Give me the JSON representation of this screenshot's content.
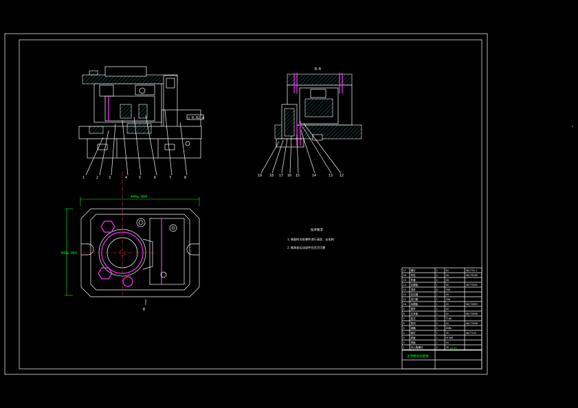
{
  "view_label_b": "B-B",
  "dim_width": "440±.080",
  "dim_height": "300±.060",
  "section_mark": "B",
  "callout_tag": "□ 0.02 A",
  "notes": {
    "title": "技术要求",
    "line1": "1.装配时对各零件进行清洗、去毛刺",
    "line2": "2.模具各运动部件应灵活可靠"
  },
  "balloons_front": [
    "1",
    "2",
    "3",
    "4",
    "5",
    "6",
    "7",
    "8"
  ],
  "balloons_side": [
    "19",
    "18",
    "17",
    "16",
    "15",
    "14",
    "13",
    "12"
  ],
  "title_block": {
    "drawing_name": "注塑模具装配图",
    "material": "Q235",
    "rows": [
      [
        "17",
        "螺钉",
        "2",
        "45",
        "GB/T70.1"
      ],
      [
        "16",
        "导柱",
        "4",
        "20",
        "GB/T4169"
      ],
      [
        "15",
        "导套",
        "4",
        "20",
        ""
      ],
      [
        "14",
        "定模板",
        "1",
        "45",
        "JB/T7642"
      ],
      [
        "13",
        "顶杆",
        "8",
        "T8A",
        ""
      ],
      [
        "12",
        "定位圈",
        "1",
        "45",
        ""
      ],
      [
        "11",
        "浇口套",
        "1",
        "T8A",
        ""
      ],
      [
        "10",
        "动模板",
        "1",
        "45",
        "GB/T2855"
      ],
      [
        "9",
        "推杆",
        "4",
        "45",
        ""
      ],
      [
        "8",
        "支承板",
        "1",
        "45",
        "GB/T2858"
      ],
      [
        "7",
        "型芯",
        "1",
        "T10A",
        ""
      ],
      [
        "6",
        "垫块",
        "2",
        "45",
        "GB/T7650"
      ],
      [
        "5",
        "弹簧",
        "4",
        "65Mn",
        ""
      ],
      [
        "4",
        "销钉",
        "2",
        "35",
        "GB/T119"
      ],
      [
        "3",
        "底板",
        "1",
        "HT200",
        ""
      ],
      [
        "2",
        "顶板",
        "1",
        "45",
        ""
      ],
      [
        "1",
        "内六角螺钉",
        "4",
        "35",
        ""
      ]
    ]
  }
}
